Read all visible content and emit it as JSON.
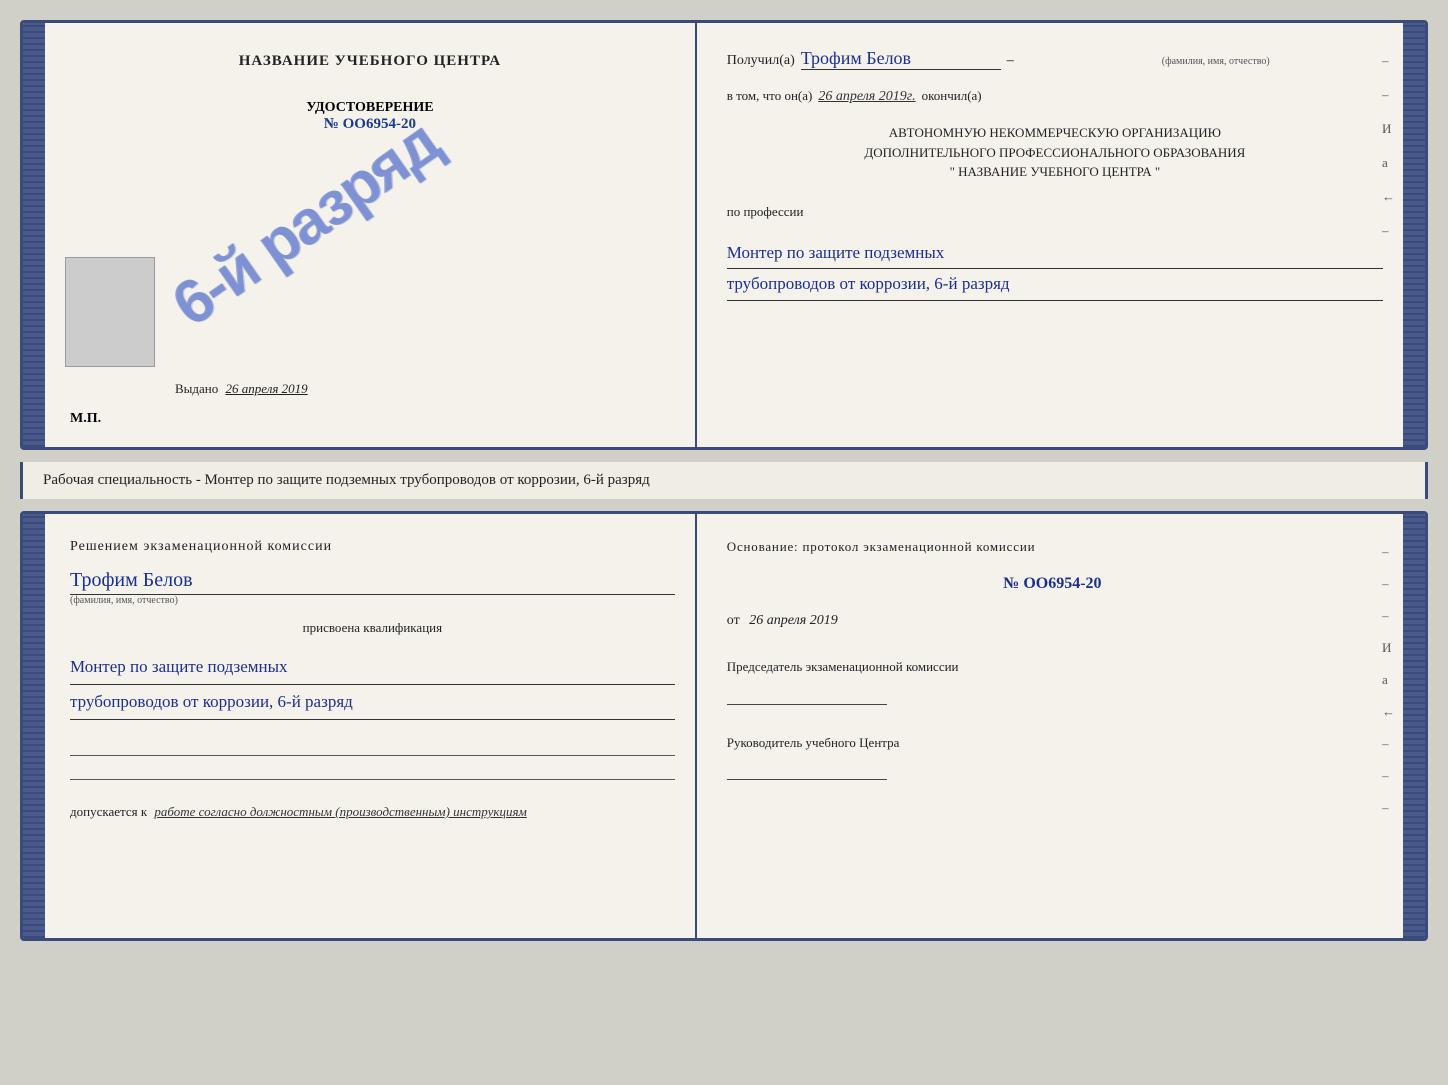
{
  "topCert": {
    "left": {
      "title": "НАЗВАНИЕ УЧЕБНОГО ЦЕНТРА",
      "photoAlt": "photo",
      "udostoverenie": "УДОСТОВЕРЕНИЕ",
      "number": "№ OO6954-20",
      "stampText": "6-й разряд",
      "vydano": "Выдано",
      "vydanoDate": "26 апреля 2019",
      "mp": "М.П."
    },
    "right": {
      "poluchilLabel": "Получил(a)",
      "nameHandwritten": "Трофим Белов",
      "nameSubLabel": "(фамилия, имя, отчество)",
      "dashLine": "–",
      "vtomLabel": "в том, что он(a)",
      "dateHandwritten": "26 апреля 2019г.",
      "okochilLabel": "окончил(a)",
      "org1": "АВТОНОМНУЮ НЕКОММЕРЧЕСКУЮ ОРГАНИЗАЦИЮ",
      "org2": "ДОПОЛНИТЕЛЬНОГО ПРОФЕССИОНАЛЬНОГО ОБРАЗОВАНИЯ",
      "org3": "\"   НАЗВАНИЕ УЧЕБНОГО ЦЕНТРА   \"",
      "poProf": "по профессии",
      "profLine1": "Монтер по защите подземных",
      "profLine2": "трубопроводов от коррозии, 6-й разряд",
      "dashes": [
        "–",
        "–",
        "И",
        "а",
        "←",
        "–"
      ]
    }
  },
  "middleText": {
    "text": "Рабочая специальность - Монтер по защите подземных трубопроводов от коррозии, 6-й разряд"
  },
  "bottomCert": {
    "left": {
      "resheniyem": "Решением  экзаменационной  комиссии",
      "name": "Трофим Белов",
      "nameSubLabel": "(фамилия, имя, отчество)",
      "prisvoena": "присвоена квалификация",
      "qualLine1": "Монтер по защите подземных",
      "qualLine2": "трубопроводов от коррозии, 6-й разряд",
      "dopuskaetsya": "допускается к",
      "workText": "работе согласно должностным (производственным) инструкциям"
    },
    "right": {
      "osnovaniye": "Основание: протокол экзаменационной  комиссии",
      "number": "№  OO6954-20",
      "ot": "от",
      "date": "26 апреля 2019",
      "predsedatelLabel": "Председатель экзаменационной комиссии",
      "rukovoditelLabel": "Руководитель учебного Центра",
      "dashes": [
        "–",
        "–",
        "–",
        "И",
        "а",
        "←",
        "–",
        "–",
        "–"
      ]
    }
  }
}
